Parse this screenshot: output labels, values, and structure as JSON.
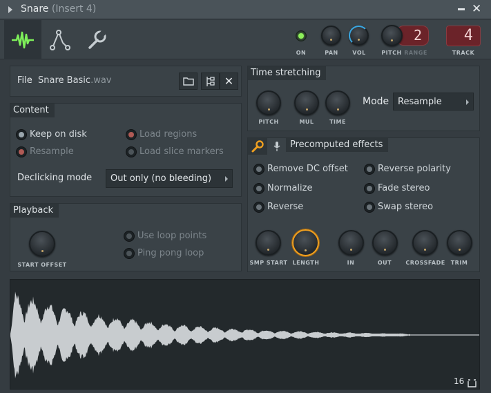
{
  "window": {
    "title": "Snare",
    "subtitle": "(Insert 4)"
  },
  "toolbar": {
    "on_label": "ON",
    "pan_label": "PAN",
    "vol_label": "VOL",
    "pitch_label": "PITCH",
    "range_label": "RANGE",
    "range_value": "2",
    "track_label": "TRACK",
    "track_value": "4",
    "on_led_color": "#8df05a"
  },
  "file": {
    "label": "File",
    "name_base": "Snare Basic",
    "name_ext": ".wav"
  },
  "content": {
    "title": "Content",
    "options": [
      {
        "label": "Keep on disk",
        "state": "enabled"
      },
      {
        "label": "Resample",
        "state": "disabled"
      },
      {
        "label": "Load regions",
        "state": "disabled"
      },
      {
        "label": "Load slice markers",
        "state": "disabled"
      }
    ],
    "declicking_label": "Declicking mode",
    "declicking_value": "Out only (no bleeding)"
  },
  "playback": {
    "title": "Playback",
    "start_offset_label": "START OFFSET",
    "use_loop_points": "Use loop points",
    "ping_pong_loop": "Ping pong loop"
  },
  "time_stretching": {
    "title": "Time stretching",
    "knobs": [
      "PITCH",
      "MUL",
      "TIME"
    ],
    "mode_label": "Mode",
    "mode_value": "Resample"
  },
  "precomputed": {
    "title": "Precomputed effects",
    "left_options": [
      "Remove DC offset",
      "Normalize",
      "Reverse"
    ],
    "right_options": [
      "Reverse polarity",
      "Fade stereo",
      "Swap stereo"
    ],
    "knobs": [
      "SMP START",
      "LENGTH",
      "IN",
      "OUT",
      "CROSSFADE",
      "TRIM"
    ],
    "accent_color": "#f0a020"
  },
  "waveform": {
    "grid_value": "16"
  }
}
